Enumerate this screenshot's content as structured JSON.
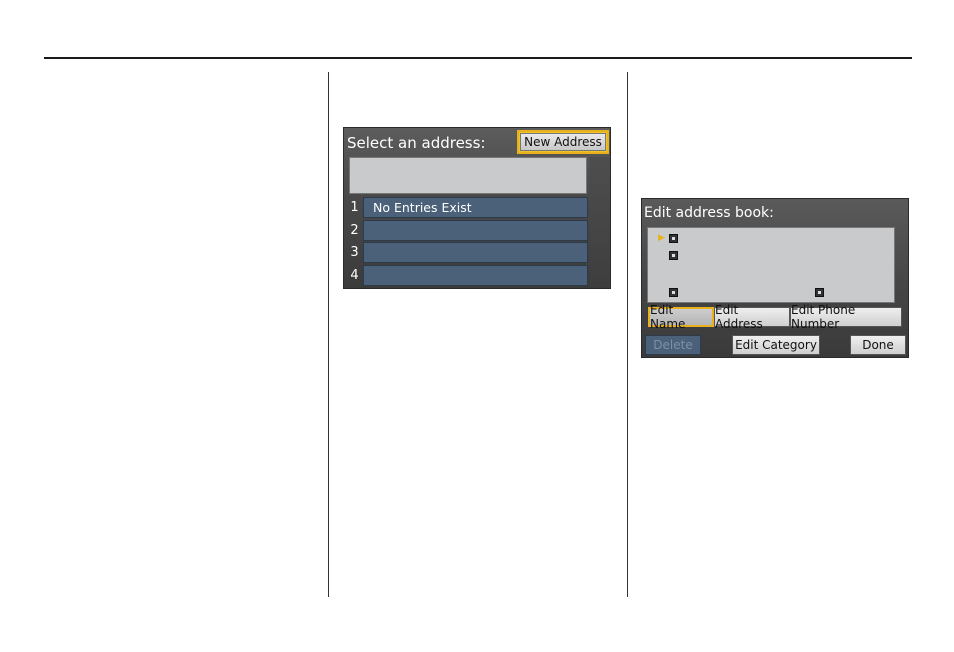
{
  "select_screen": {
    "title": "Select an address:",
    "new_address_label": "New Address",
    "rows": [
      {
        "num": "1",
        "text": "No Entries Exist"
      },
      {
        "num": "2",
        "text": ""
      },
      {
        "num": "3",
        "text": ""
      },
      {
        "num": "4",
        "text": ""
      }
    ]
  },
  "edit_screen": {
    "title": "Edit address book:",
    "tabs": {
      "edit_name": "Edit Name",
      "edit_address": "Edit Address",
      "edit_phone": "Edit Phone Number"
    },
    "buttons": {
      "delete": "Delete",
      "edit_category": "Edit Category",
      "done": "Done"
    }
  },
  "colors": {
    "highlight": "#e8b21e",
    "row_blue": "#4a6179",
    "field_gray": "#c9cacb"
  }
}
